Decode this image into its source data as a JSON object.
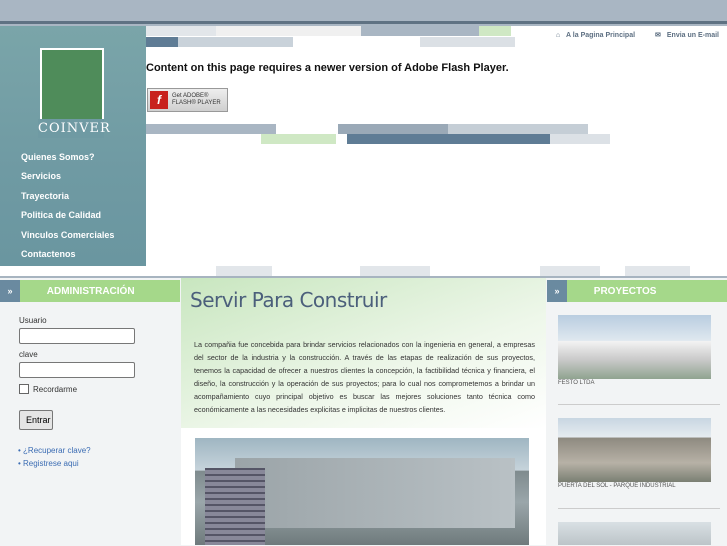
{
  "header": {
    "home_link": "A la Pagina Principal",
    "email_link": "Envia un E-mail",
    "home_icon": "home-icon",
    "email_icon": "envelope-icon",
    "flash_message": "Content on this page requires a newer version of Adobe Flash Player.",
    "flash_button_line1": "Get ADOBE®",
    "flash_button_line2": "FLASH® PLAYER"
  },
  "logo": {
    "text": "COINVER"
  },
  "menu": {
    "items": [
      {
        "label": "Quienes Somos?"
      },
      {
        "label": "Servicios"
      },
      {
        "label": "Trayectoria"
      },
      {
        "label": "Politica de Calidad"
      },
      {
        "label": "Vinculos Comerciales"
      },
      {
        "label": "Contactenos"
      }
    ]
  },
  "admin": {
    "title": "ADMINISTRACIÓN",
    "arrow": "»",
    "user_label": "Usuario",
    "pass_label": "clave",
    "remember_label": "Recordarme",
    "submit_label": "Entrar",
    "recover_link": "¿Recuperar clave?",
    "register_link": "Registrese aqui"
  },
  "main": {
    "title": "Servir Para Construir",
    "body": "La compañia fue concebida para brindar servicios relacionados con la ingenieria en general, a empresas del sector de la industria y la construcción. A través de las etapas de realización de sus proyectos, tenemos la capacidad de ofrecer a nuestros clientes la concepción, la factibilidad técnica y financiera, el diseño, la construcción y la operación de sus proyectos; para lo cual nos comprometemos a brindar un acompañamiento cuyo principal objetivo es buscar las mejores soluciones tanto técnica como económicamente a las necesidades explicitas e implicitas de nuestros clientes."
  },
  "projects": {
    "title": "PROYECTOS",
    "arrow": "»",
    "items": [
      {
        "caption": "FESTO LTDA"
      },
      {
        "caption": "PUERTA DEL SOL - PARQUE INDUSTRIAL"
      },
      {
        "caption": ""
      }
    ]
  },
  "colors": {
    "accent_green": "#a5d88a",
    "menu_teal": "#6f9aa3",
    "title_blue": "#4b5f7b"
  }
}
